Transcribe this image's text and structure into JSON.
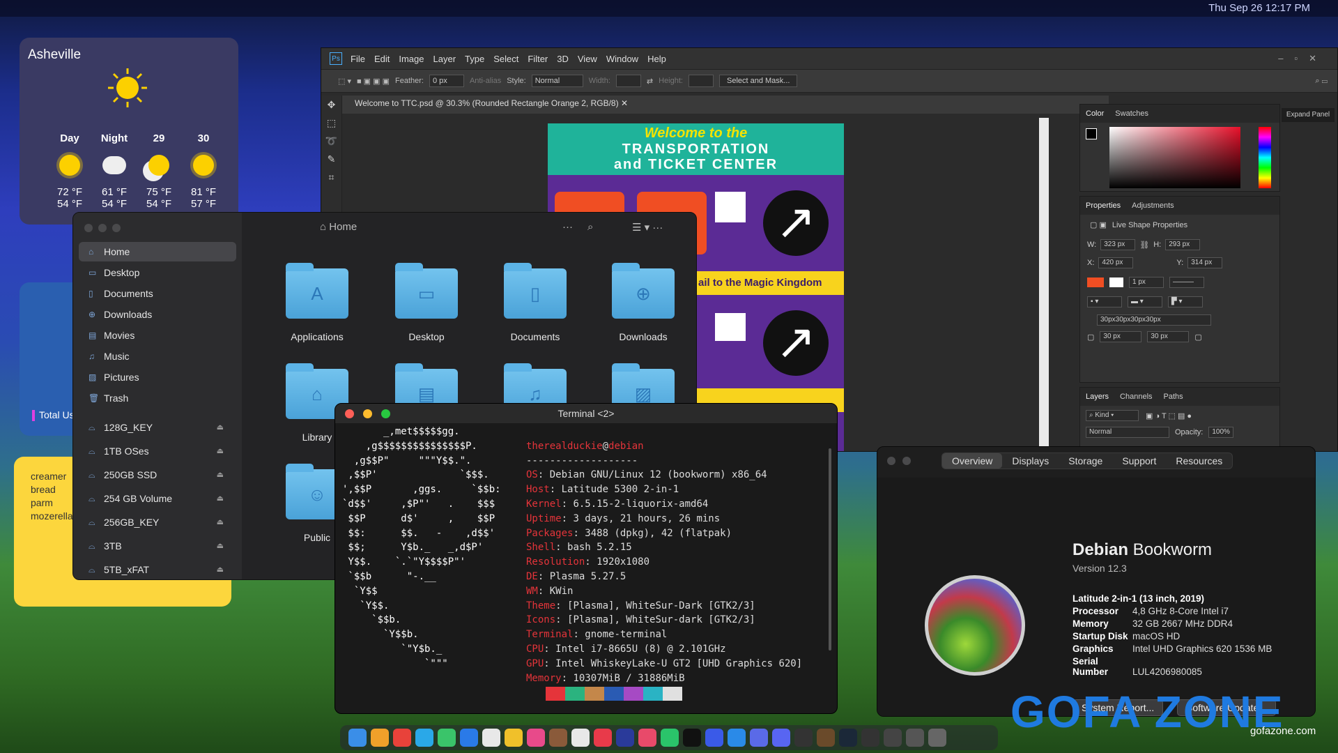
{
  "topbar": {
    "clock": "Thu Sep 26 12:17 PM"
  },
  "weather": {
    "city": "Asheville",
    "cols": [
      {
        "label": "Day",
        "high": "72 °F",
        "low": "54 °F"
      },
      {
        "label": "Night",
        "high": "61 °F",
        "low": "54 °F"
      },
      {
        "label": "29",
        "high": "75 °F",
        "low": "54 °F"
      },
      {
        "label": "30",
        "high": "81 °F",
        "low": "57 °F"
      }
    ]
  },
  "card": {
    "label": "Total Us"
  },
  "sticky": {
    "lines": [
      "creamer",
      "bread",
      "parm",
      "mozerella"
    ]
  },
  "photoshop": {
    "menu": [
      "File",
      "Edit",
      "Image",
      "Layer",
      "Type",
      "Select",
      "Filter",
      "3D",
      "View",
      "Window",
      "Help"
    ],
    "opts": {
      "feather_label": "Feather:",
      "feather": "0 px",
      "antialias": "Anti-alias",
      "style_label": "Style:",
      "style": "Normal",
      "width_label": "Width:",
      "height_label": "Height:",
      "select_mask": "Select and Mask..."
    },
    "tab": "Welcome to TTC.psd @ 30.3% (Rounded Rectangle Orange 2, RGB/8)",
    "canvas": {
      "welcome": "Welcome to the",
      "line1": "TRANSPORTATION",
      "line2": "and TICKET CENTER",
      "banner": "ail to the Magic Kingdom"
    },
    "color_tabs": [
      "Color",
      "Swatches"
    ],
    "props_tabs": [
      "Properties",
      "Adjustments"
    ],
    "live_shape": "Live Shape Properties",
    "w_label": "W:",
    "w": "323 px",
    "h_label": "H:",
    "h": "293 px",
    "x_label": "X:",
    "x": "420 px",
    "y_label": "Y:",
    "y": "314 px",
    "stroke": "1 px",
    "radius_all": "30px30px30px30px",
    "r1": "30 px",
    "r2": "30 px",
    "layers_tabs": [
      "Layers",
      "Channels",
      "Paths"
    ],
    "kind": "Kind",
    "blend": "Normal",
    "opacity_label": "Opacity:",
    "opacity": "100%",
    "expand": "Expand Panel"
  },
  "finder": {
    "title": "Home",
    "side": [
      {
        "label": "Home",
        "icon": "house-icon"
      },
      {
        "label": "Desktop",
        "icon": "desktop-icon"
      },
      {
        "label": "Documents",
        "icon": "document-icon"
      },
      {
        "label": "Downloads",
        "icon": "download-icon"
      },
      {
        "label": "Movies",
        "icon": "film-icon"
      },
      {
        "label": "Music",
        "icon": "music-icon"
      },
      {
        "label": "Pictures",
        "icon": "picture-icon"
      },
      {
        "label": "Trash",
        "icon": "trash-icon"
      }
    ],
    "drives": [
      "128G_KEY",
      "1TB OSes",
      "250GB SSD",
      "254 GB Volume",
      "256GB_KEY",
      "3TB",
      "5TB_xFAT"
    ],
    "folders": [
      "Applications",
      "Desktop",
      "Documents",
      "Downloads",
      "Library",
      "Public"
    ]
  },
  "terminal": {
    "title": "Terminal <2>",
    "user": "therealduckie",
    "at": "@",
    "host": "debian",
    "sep": "-------------------",
    "info": [
      {
        "k": "OS",
        "v": "Debian GNU/Linux 12 (bookworm) x86_64"
      },
      {
        "k": "Host",
        "v": "Latitude 5300 2-in-1"
      },
      {
        "k": "Kernel",
        "v": "6.5.15-2-liquorix-amd64"
      },
      {
        "k": "Uptime",
        "v": "3 days, 21 hours, 26 mins"
      },
      {
        "k": "Packages",
        "v": "3488 (dpkg), 42 (flatpak)"
      },
      {
        "k": "Shell",
        "v": "bash 5.2.15"
      },
      {
        "k": "Resolution",
        "v": "1920x1080"
      },
      {
        "k": "DE",
        "v": "Plasma 5.27.5"
      },
      {
        "k": "WM",
        "v": "KWin"
      },
      {
        "k": "Theme",
        "v": "[Plasma], WhiteSur-Dark [GTK2/3]"
      },
      {
        "k": "Icons",
        "v": "[Plasma], WhiteSur-dark [GTK2/3]"
      },
      {
        "k": "Terminal",
        "v": "gnome-terminal"
      },
      {
        "k": "CPU",
        "v": "Intel i7-8665U (8) @ 2.101GHz"
      },
      {
        "k": "GPU",
        "v": "Intel WhiskeyLake-U GT2 [UHD Graphics 620]"
      },
      {
        "k": "Memory",
        "v": "10307MiB / 31886MiB"
      }
    ],
    "logo": "       _,met$$$$$gg.\n    ,g$$$$$$$$$$$$$$$P.\n  ,g$$P\"     \"\"\"Y$$.\".\n ,$$P'              `$$$.\n',$$P       ,ggs.     `$$b:\n`d$$'     ,$P\"'   .    $$$\n $$P      d$'     ,    $$P\n $$:      $$.   -    ,d$$'\n $$;      Y$b._   _,d$P'\n Y$$.    `.`\"Y$$$$P\"'\n `$$b      \"-.__\n  `Y$$\n   `Y$$.\n     `$$b.\n       `Y$$b.\n          `\"Y$b._\n              `\"\"\"",
    "palette": [
      "#1a1a1a",
      "#e5343a",
      "#2bb37f",
      "#c4874a",
      "#2a5bb3",
      "#a64ac4",
      "#2ab3c4",
      "#e0e0e0"
    ]
  },
  "about": {
    "tabs": [
      "Overview",
      "Displays",
      "Storage",
      "Support",
      "Resources"
    ],
    "name1": "Debian",
    "name2": " Bookworm",
    "version": "Version 12.3",
    "model": "Latitude 2-in-1 (13 inch, 2019)",
    "specs": [
      {
        "k": "Processor",
        "v": "4,8 GHz 8-Core Intel i7"
      },
      {
        "k": "Memory",
        "v": "32 GB 2667 MHz DDR4"
      },
      {
        "k": "Startup Disk",
        "v": "macOS HD"
      },
      {
        "k": "Graphics",
        "v": "Intel UHD Graphics 620 1536 MB"
      },
      {
        "k": "Serial Number",
        "v": "LUL4206980085"
      }
    ],
    "btn1": "System Report...",
    "btn2": "Software Update..."
  },
  "dock": {
    "colors": [
      "#3a8ee8",
      "#f0a02a",
      "#e8423a",
      "#2aa8e8",
      "#3ac46a",
      "#2a7ae8",
      "#e8e8e8",
      "#f0c02a",
      "#e84a8a",
      "#8a5a3a",
      "#e8e8e8",
      "#e83a4a",
      "#2a3a9a",
      "#e84a6a",
      "#2ac46a",
      "#111",
      "#3a5ae8",
      "#2a8ae8",
      "#5a6ae8",
      "#5865f2",
      "#333",
      "#6a4a2a",
      "#1b2838",
      "#333",
      "#444",
      "#555",
      "#666"
    ]
  },
  "watermark": {
    "text": "GOFA ZONE",
    "site": "gofazone.com"
  }
}
